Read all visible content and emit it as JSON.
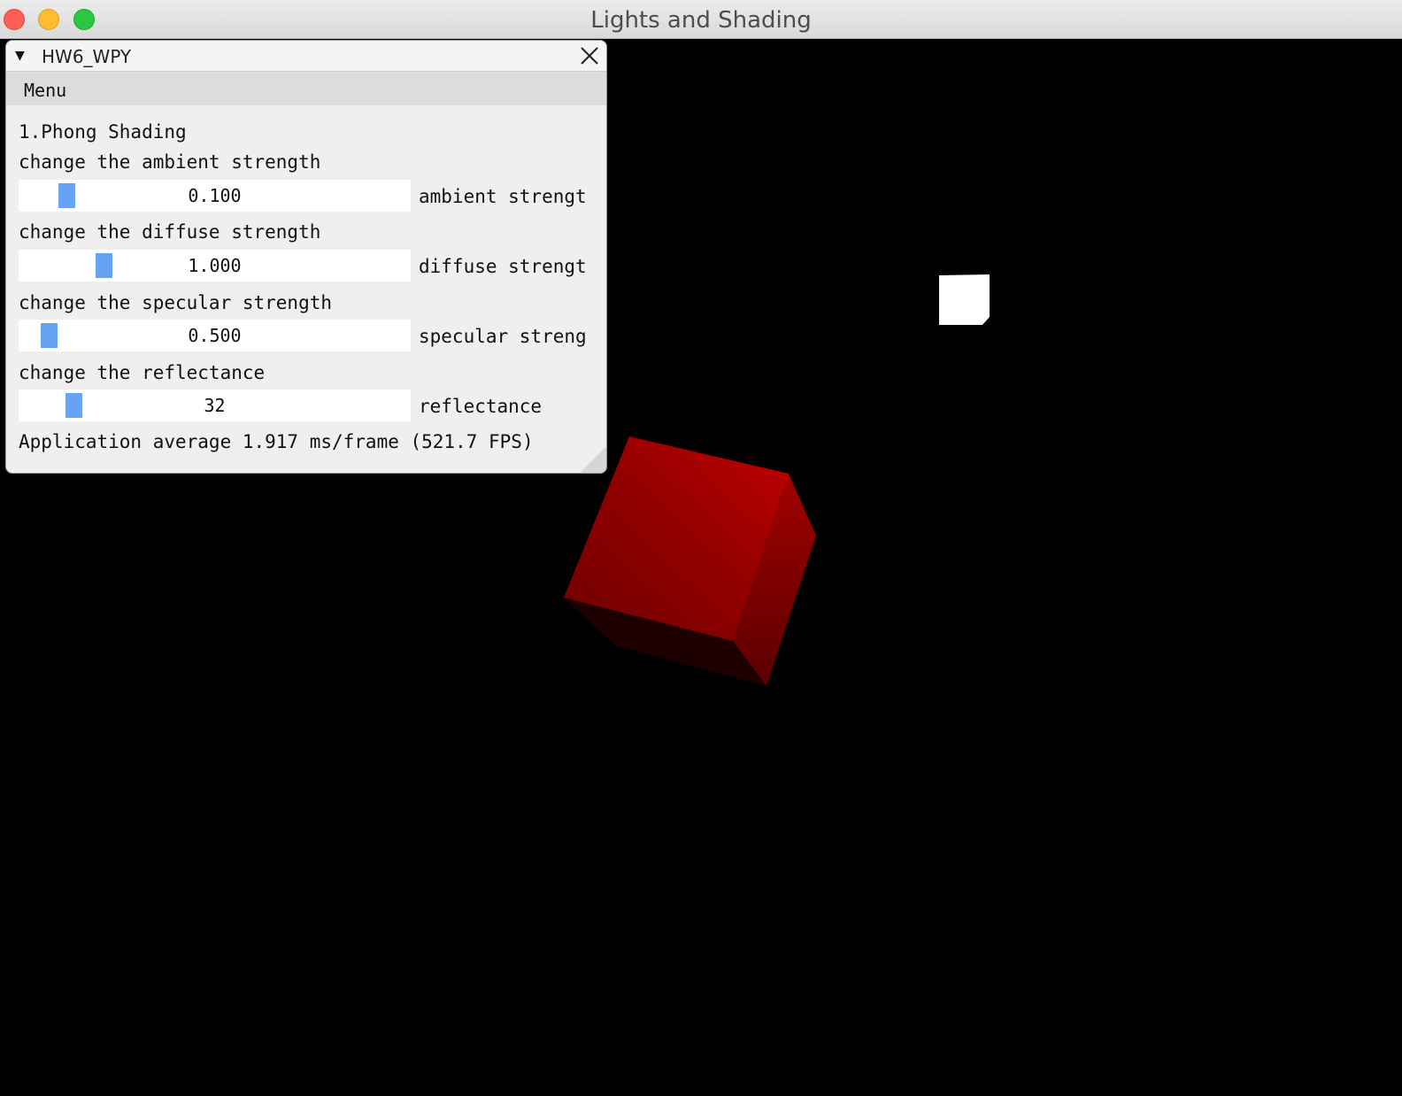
{
  "window": {
    "title": "Lights and Shading"
  },
  "panel": {
    "title": "HW6_WPY",
    "menu_label": "Menu",
    "section_title": "1.Phong Shading",
    "controls": [
      {
        "prompt": "change the ambient strength",
        "value": "0.100",
        "label": "ambient strengt"
      },
      {
        "prompt": "change the diffuse strength",
        "value": "1.000",
        "label": "diffuse strengt"
      },
      {
        "prompt": "change the specular strength",
        "value": "0.500",
        "label": "specular streng"
      },
      {
        "prompt": "change the reflectance",
        "value": "32",
        "label": "reflectance"
      }
    ],
    "stats": "Application average 1.917 ms/frame (521.7 FPS)"
  },
  "scene": {
    "background_color": "#000000",
    "cube_color": "#b30000",
    "light_color": "#ffffff"
  }
}
